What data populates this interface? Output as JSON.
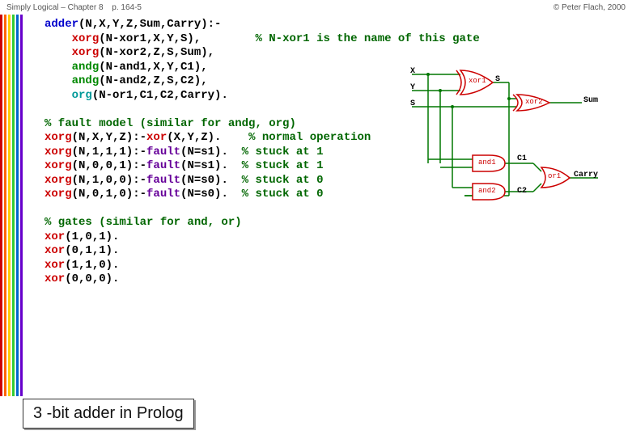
{
  "header": {
    "book": "Simply Logical – Chapter 8",
    "pageref": "p. 164-5",
    "copyright": "© Peter Flach, 2000"
  },
  "rails": [
    "#cc0000",
    "#ff6600",
    "#ffcc00",
    "#33cc33",
    "#0066cc",
    "#6600cc"
  ],
  "title": "3 -bit adder in Prolog",
  "diagram": {
    "inputs": {
      "x": "X",
      "y": "Y",
      "s": "S"
    },
    "gates": {
      "xor1": "xor1",
      "xor2": "xor2",
      "and1": "and1",
      "and2": "and2",
      "or1": "or1"
    },
    "nets": {
      "sInt": "S",
      "c1": "C1",
      "c2": "C2"
    },
    "outputs": {
      "sum": "Sum",
      "carry": "Carry"
    }
  },
  "code": {
    "b1": {
      "l1a": "adder",
      "l1b": "(N,X,Y,Z,Sum,Carry):-",
      "l2a": "xorg",
      "l2b": "(N-xor1,X,Y,S),",
      "l2c": "% N-xor1 is the name of this gate",
      "l3a": "xorg",
      "l3b": "(N-xor2,Z,S,Sum),",
      "l4a": "andg",
      "l4b": "(N-and1,X,Y,C1),",
      "l5a": "andg",
      "l5b": "(N-and2,Z,S,C2),",
      "l6a": "org",
      "l6b": "(N-or1,C1,C2,Carry)."
    },
    "b2": {
      "h": "% fault model (similar for andg, org)",
      "l1a": "xorg",
      "l1b": "(N,X,Y,Z):-",
      "l1c": "xor",
      "l1d": "(X,Y,Z).",
      "l1e": "% normal operation",
      "l2a": "xorg",
      "l2b": "(N,1,1,1):-",
      "l2c": "fault",
      "l2d": "(N=s1).",
      "l2e": "% stuck at 1",
      "l3a": "xorg",
      "l3b": "(N,0,0,1):-",
      "l3c": "fault",
      "l3d": "(N=s1).",
      "l3e": "% stuck at 1",
      "l4a": "xorg",
      "l4b": "(N,1,0,0):-",
      "l4c": "fault",
      "l4d": "(N=s0).",
      "l4e": "% stuck at 0",
      "l5a": "xorg",
      "l5b": "(N,0,1,0):-",
      "l5c": "fault",
      "l5d": "(N=s0).",
      "l5e": "% stuck at 0"
    },
    "b3": {
      "h": "% gates (similar for and, or)",
      "l1a": "xor",
      "l1b": "(1,0,1).",
      "l2a": "xor",
      "l2b": "(0,1,1).",
      "l3a": "xor",
      "l3b": "(1,1,0).",
      "l4a": "xor",
      "l4b": "(0,0,0)."
    }
  }
}
